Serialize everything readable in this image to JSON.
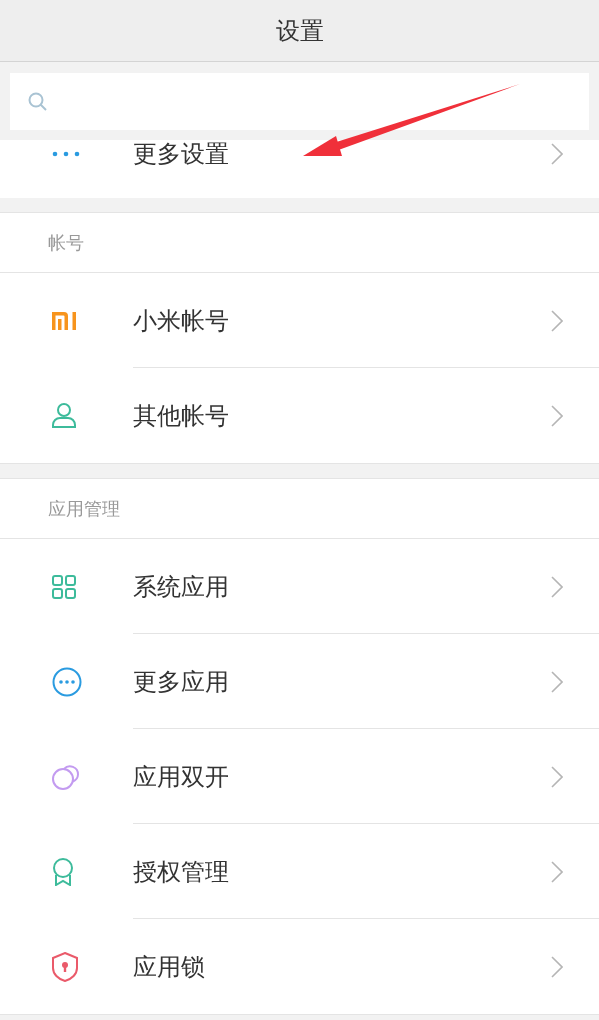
{
  "header": {
    "title": "设置"
  },
  "search": {
    "kind": "search"
  },
  "top_item": {
    "kind": "dots",
    "label": "更多设置"
  },
  "sections": [
    {
      "title": "帐号",
      "items": [
        {
          "kind": "logo",
          "label": "小米帐号"
        },
        {
          "kind": "person",
          "label": "其他帐号"
        }
      ]
    },
    {
      "title": "应用管理",
      "items": [
        {
          "kind": "grid",
          "label": "系统应用"
        },
        {
          "kind": "more-circle",
          "label": "更多应用"
        },
        {
          "kind": "dual",
          "label": "应用双开"
        },
        {
          "kind": "badge",
          "label": "授权管理"
        },
        {
          "kind": "shield",
          "label": "应用锁"
        }
      ]
    }
  ],
  "annotation": {
    "kind": "arrow"
  }
}
